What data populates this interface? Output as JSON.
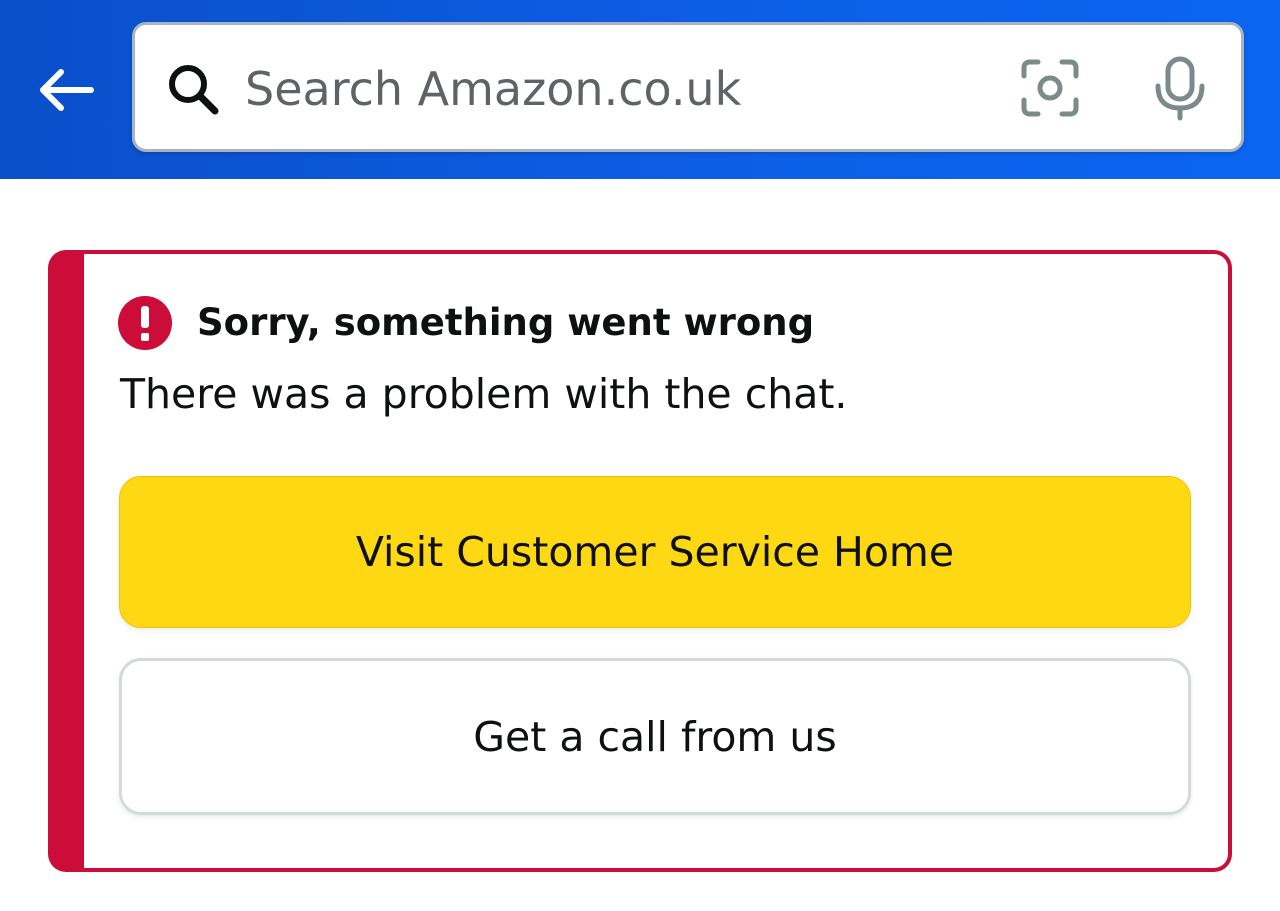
{
  "header": {
    "background_color": "#0d5ee6",
    "back_icon": "arrow-left-icon",
    "search": {
      "placeholder": "Search Amazon.co.uk",
      "value": "",
      "search_icon": "search-icon",
      "camera_icon": "camera-icon",
      "mic_icon": "microphone-icon"
    }
  },
  "error_card": {
    "accent_color": "#cc0c39",
    "alert_icon": "exclamation-alert-icon",
    "title": "Sorry, something went wrong",
    "message": "There was a problem with the chat.",
    "primary_button": {
      "label": "Visit Customer Service Home",
      "color": "#ffd814"
    },
    "secondary_button": {
      "label": "Get a call from us"
    }
  }
}
